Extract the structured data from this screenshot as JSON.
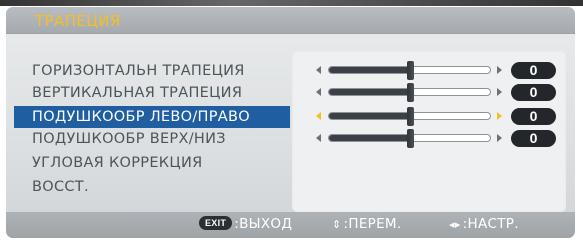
{
  "menu": {
    "title": "ТРАПЕЦИЯ",
    "items": [
      {
        "label": "ГОРИЗОНТАЛЬН ТРАПЕЦИЯ",
        "value": "0",
        "has_slider": true,
        "selected": false,
        "level": 0.5
      },
      {
        "label": "ВЕРТИКАЛЬНАЯ ТРАПЕЦИЯ",
        "value": "0",
        "has_slider": true,
        "selected": false,
        "level": 0.5
      },
      {
        "label": "ПОДУШКООБР ЛЕВО/ПРАВО",
        "value": "0",
        "has_slider": true,
        "selected": true,
        "level": 0.5
      },
      {
        "label": "ПОДУШКООБР ВЕРХ/НИЗ",
        "value": "0",
        "has_slider": true,
        "selected": false,
        "level": 0.5
      },
      {
        "label": "УГЛОВАЯ КОРРЕКЦИЯ",
        "has_slider": false,
        "selected": false
      },
      {
        "label": "ВОССТ.",
        "has_slider": false,
        "selected": false
      }
    ]
  },
  "footer": {
    "exit_key": "EXIT",
    "exit_label": ":ВЫХОД",
    "move_symbol": "⇕",
    "move_label": ":ПЕРЕМ.",
    "adjust_symbol": "◂▸",
    "adjust_label": ":НАСТР."
  },
  "colors": {
    "title": "#f4c021",
    "selection": "#1f5ea0",
    "selected_arrows": "#f4c021",
    "item_text": "#4d555b",
    "value_box": "#23272b"
  }
}
